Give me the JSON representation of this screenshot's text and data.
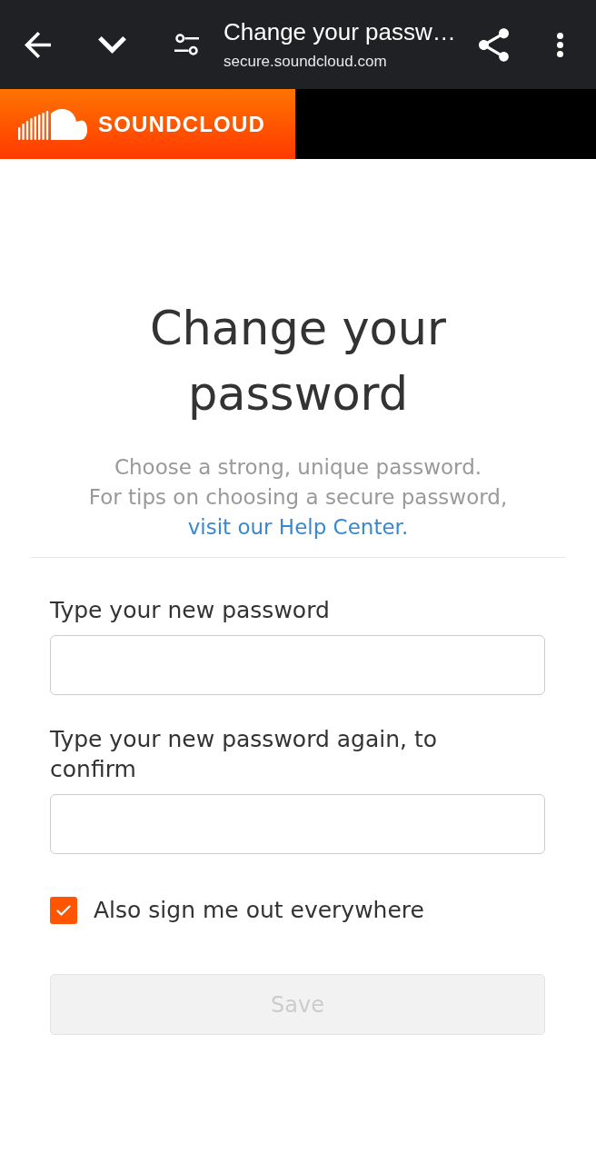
{
  "browser_bar": {
    "page_title": "Change your passw…",
    "url": "secure.soundcloud.com"
  },
  "site_header": {
    "logo_text": "SOUNDCLOUD"
  },
  "page": {
    "title": "Change your password",
    "intro": {
      "line_1": "Choose a strong, unique password.",
      "line_2": "For tips on choosing a secure password,",
      "link": "visit our Help Center."
    }
  },
  "fields": [
    {
      "label": "Type your new password"
    },
    {
      "label": "Type your new password again, to confirm"
    }
  ],
  "checkbox": {
    "label": "Also sign me out everywhere",
    "checked": true
  },
  "save_button": {
    "label": "Save",
    "disabled": true
  }
}
